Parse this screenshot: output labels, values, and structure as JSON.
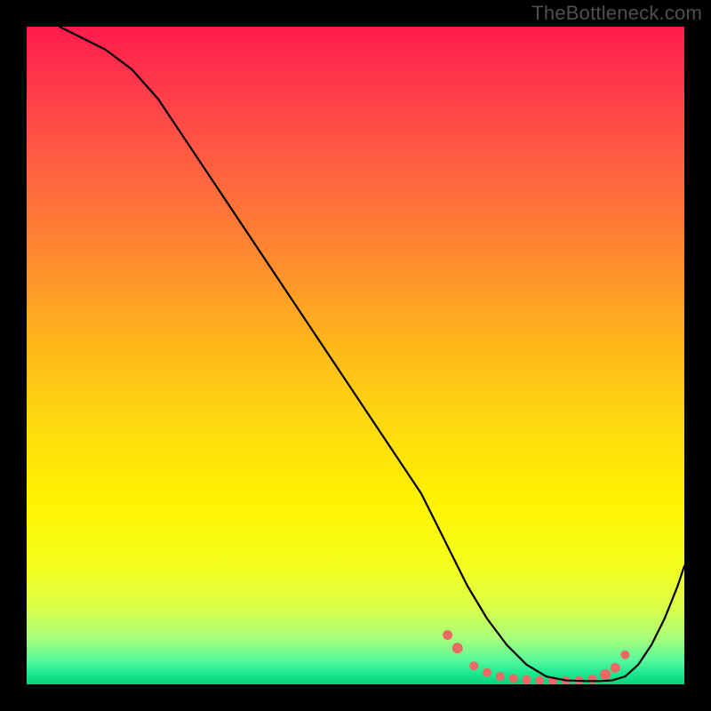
{
  "watermark": "TheBottleneck.com",
  "chart_data": {
    "type": "line",
    "title": "",
    "xlabel": "",
    "ylabel": "",
    "xlim": [
      0,
      100
    ],
    "ylim": [
      0,
      100
    ],
    "grid": false,
    "legend": false,
    "series": [
      {
        "name": "curve",
        "x": [
          5,
          8,
          12,
          16,
          20,
          24,
          28,
          32,
          36,
          40,
          44,
          48,
          52,
          56,
          60,
          63,
          65,
          67,
          70,
          73,
          76,
          79,
          82,
          85,
          87,
          89,
          91,
          93,
          95,
          97,
          99,
          100
        ],
        "y": [
          100,
          98.5,
          96.5,
          93.5,
          89,
          83,
          77,
          71,
          65,
          59,
          53,
          47,
          41,
          35,
          29,
          23,
          19,
          15,
          10,
          6,
          3,
          1.2,
          0.6,
          0.5,
          0.5,
          0.6,
          1.2,
          3,
          6,
          10,
          15,
          18
        ],
        "color": "#000000",
        "line_width": 2.2
      }
    ],
    "markers": [
      {
        "name": "marker",
        "x": 64,
        "y": 7.5,
        "r": 5.5,
        "color": "#ec6a66"
      },
      {
        "name": "marker",
        "x": 65.5,
        "y": 5.5,
        "r": 6.0,
        "color": "#ec6a66"
      },
      {
        "name": "marker",
        "x": 68,
        "y": 2.8,
        "r": 5.0,
        "color": "#ec6a66"
      },
      {
        "name": "marker",
        "x": 70,
        "y": 1.8,
        "r": 5.0,
        "color": "#ec6a66"
      },
      {
        "name": "marker",
        "x": 72,
        "y": 1.2,
        "r": 5.0,
        "color": "#ec6a66"
      },
      {
        "name": "marker",
        "x": 74,
        "y": 0.9,
        "r": 5.0,
        "color": "#ec6a66"
      },
      {
        "name": "marker",
        "x": 76,
        "y": 0.7,
        "r": 5.0,
        "color": "#ec6a66"
      },
      {
        "name": "marker",
        "x": 78,
        "y": 0.6,
        "r": 5.0,
        "color": "#ec6a66"
      },
      {
        "name": "marker",
        "x": 80,
        "y": 0.55,
        "r": 5.0,
        "color": "#ec6a66"
      },
      {
        "name": "marker",
        "x": 82,
        "y": 0.55,
        "r": 5.0,
        "color": "#ec6a66"
      },
      {
        "name": "marker",
        "x": 84,
        "y": 0.6,
        "r": 5.0,
        "color": "#ec6a66"
      },
      {
        "name": "marker",
        "x": 86,
        "y": 0.8,
        "r": 5.0,
        "color": "#ec6a66"
      },
      {
        "name": "marker",
        "x": 88,
        "y": 1.5,
        "r": 6.0,
        "color": "#ec6a66"
      },
      {
        "name": "marker",
        "x": 89.5,
        "y": 2.5,
        "r": 5.5,
        "color": "#ec6a66"
      },
      {
        "name": "marker",
        "x": 91,
        "y": 4.5,
        "r": 5.0,
        "color": "#ec6a66"
      }
    ],
    "gradient_stops": [
      {
        "offset": 0.0,
        "color": "#ff1a4c"
      },
      {
        "offset": 0.1,
        "color": "#ff3d4a"
      },
      {
        "offset": 0.22,
        "color": "#ff6240"
      },
      {
        "offset": 0.35,
        "color": "#ff8a30"
      },
      {
        "offset": 0.48,
        "color": "#ffb61a"
      },
      {
        "offset": 0.6,
        "color": "#ffd80f"
      },
      {
        "offset": 0.72,
        "color": "#fff200"
      },
      {
        "offset": 0.82,
        "color": "#f4ff1c"
      },
      {
        "offset": 0.885,
        "color": "#d9ff4a"
      },
      {
        "offset": 0.93,
        "color": "#a8ff7a"
      },
      {
        "offset": 0.965,
        "color": "#54f79c"
      },
      {
        "offset": 0.985,
        "color": "#18e88f"
      },
      {
        "offset": 1.0,
        "color": "#0bd17b"
      }
    ]
  }
}
